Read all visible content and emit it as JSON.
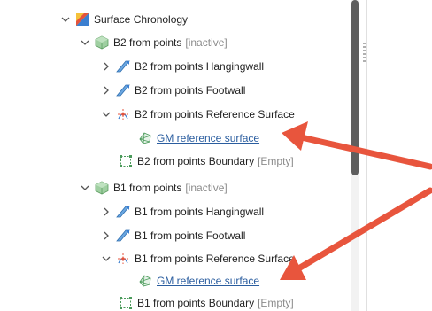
{
  "tree": {
    "root": {
      "label": "Surface Chronology"
    },
    "b2": {
      "label": "B2 from points",
      "tag": "[inactive]",
      "hangingwall": "B2 from points Hangingwall",
      "footwall": "B2 from points Footwall",
      "reference": "B2 from points Reference Surface",
      "gm_link": "GM reference surface",
      "boundary": "B2 from points Boundary",
      "boundary_tag": "[Empty]"
    },
    "b1": {
      "label": "B1 from points",
      "tag": "[inactive]",
      "hangingwall": "B1 from points Hangingwall",
      "footwall": "B1 from points Footwall",
      "reference": "B1 from points Reference Surface",
      "gm_link": "GM reference surface",
      "boundary": "B1 from points Boundary",
      "boundary_tag": "[Empty]"
    }
  },
  "colors": {
    "arrow": "#e8553d",
    "link": "#2a5d9f",
    "scrollbar_thumb": "#5e5e5e"
  },
  "icons": {
    "chronology": "chronology-icon",
    "block": "block-icon",
    "surface": "surface-icon",
    "reference": "reference-surface-icon",
    "mesh": "mesh-icon",
    "boundary": "boundary-icon"
  }
}
